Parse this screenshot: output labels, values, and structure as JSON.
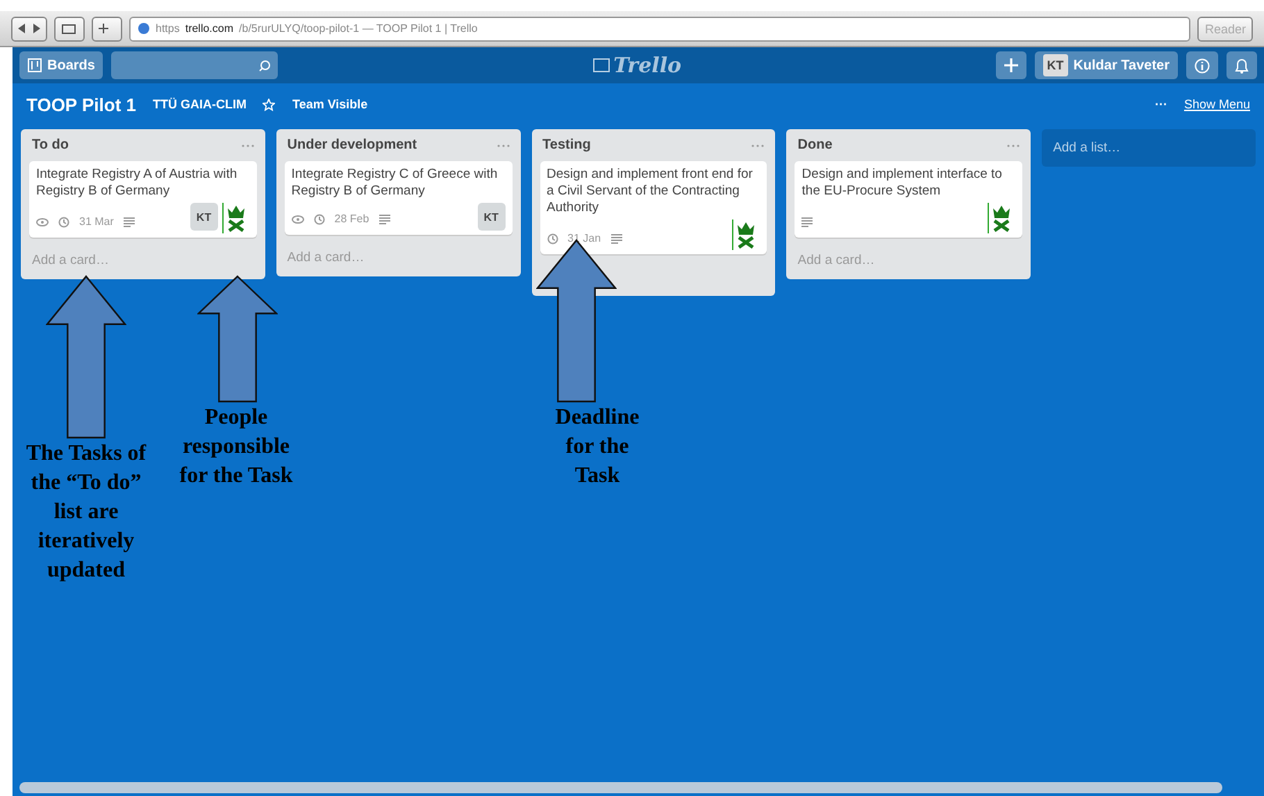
{
  "browser": {
    "url_scheme": "https",
    "url_host": "trello.com",
    "url_path": "/b/5rurULYQ/toop-pilot-1",
    "page_title": "— TOOP Pilot 1 | Trello",
    "reader": "Reader"
  },
  "header": {
    "boards": "Boards",
    "logo": "Trello",
    "user_initials": "KT",
    "user_name": "Kuldar Taveter"
  },
  "board": {
    "title": "TOOP Pilot 1",
    "organization": "TTÜ GAIA-CLIM",
    "visibility": "Team Visible",
    "menu_dots": "···",
    "show_menu": "Show Menu"
  },
  "lists": [
    {
      "title": "To do",
      "cards": [
        {
          "text": "Integrate Registry A of Austria with Registry B of Germany",
          "watched": true,
          "due": "31 Mar",
          "description": true,
          "members": [
            {
              "kind": "initials",
              "text": "KT"
            },
            {
              "kind": "logo"
            }
          ]
        }
      ],
      "add_card": "Add a card…"
    },
    {
      "title": "Under development",
      "cards": [
        {
          "text": "Integrate Registry C of Greece with Registry B of Germany",
          "watched": true,
          "due": "28 Feb",
          "description": true,
          "members": [
            {
              "kind": "initials",
              "text": "KT"
            }
          ]
        }
      ],
      "add_card": "Add a card…"
    },
    {
      "title": "Testing",
      "cards": [
        {
          "text": "Design and implement front end for a Civil Servant of the Contracting Authority",
          "watched": false,
          "due": "31 Jan",
          "description": true,
          "members": [
            {
              "kind": "logo"
            }
          ]
        }
      ]
    },
    {
      "title": "Done",
      "cards": [
        {
          "text": "Design and implement interface to the EU-Procure System",
          "watched": false,
          "description": true,
          "members": [
            {
              "kind": "logo"
            }
          ]
        }
      ],
      "add_card": "Add a card…"
    }
  ],
  "add_list": "Add a list…",
  "annotations": [
    {
      "text": "The Tasks of the “To do” list are iteratively updated"
    },
    {
      "text": "People responsible for the Task"
    },
    {
      "text": "Deadline for the Task"
    }
  ]
}
